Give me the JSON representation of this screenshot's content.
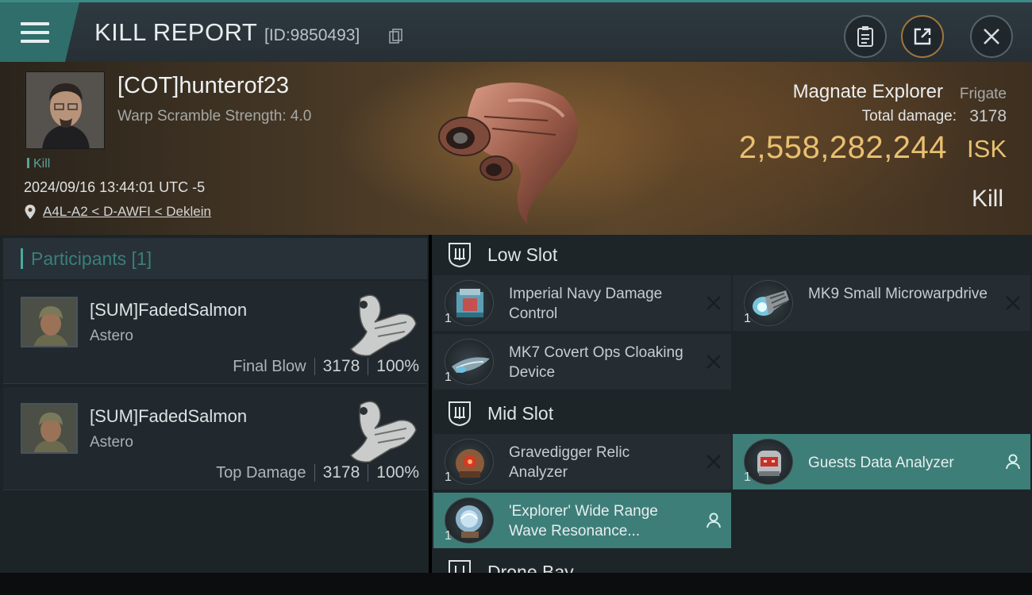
{
  "header": {
    "title": "KILL REPORT",
    "report_id": "[ID:9850493]"
  },
  "victim": {
    "name": "[COT]hunterof23",
    "warp_scramble": "Warp Scramble Strength: 4.0",
    "tag": "Kill",
    "datetime": "2024/09/16 13:44:01 UTC -5",
    "location": "A4L-A2 < D-AWFI < Deklein",
    "ship_name": "Magnate Explorer",
    "ship_class": "Frigate",
    "total_damage_label": "Total damage:",
    "total_damage": "3178",
    "isk_value": "2,558,282,244",
    "isk_unit": "ISK",
    "result": "Kill"
  },
  "participants": {
    "header": "Participants [1]",
    "rows": [
      {
        "name": "[SUM]FadedSalmon",
        "ship": "Astero",
        "role": "Final Blow",
        "damage": "3178",
        "percent": "100%"
      },
      {
        "name": "[SUM]FadedSalmon",
        "ship": "Astero",
        "role": "Top Damage",
        "damage": "3178",
        "percent": "100%"
      }
    ]
  },
  "slots": {
    "low": {
      "title": "Low Slot",
      "modules": [
        {
          "name": "Imperial Navy Damage Control",
          "qty": "1",
          "status": "destroyed"
        },
        {
          "name": "MK9 Small Microwarpdrive",
          "qty": "1",
          "status": "destroyed"
        },
        {
          "name": "MK7 Covert Ops Cloaking Device",
          "qty": "1",
          "status": "destroyed"
        }
      ]
    },
    "mid": {
      "title": "Mid Slot",
      "modules": [
        {
          "name": "Gravedigger Relic Analyzer",
          "qty": "1",
          "status": "destroyed"
        },
        {
          "name": "Guests Data Analyzer",
          "qty": "1",
          "status": "dropped"
        },
        {
          "name": "'Explorer' Wide Range Wave Resonance...",
          "qty": "1",
          "status": "dropped"
        }
      ]
    },
    "drone": {
      "title": "Drone Bay"
    }
  },
  "colors": {
    "accent_teal": "#3d7e78",
    "isk_gold": "#e8c070",
    "panel_bg": "#1e2529"
  }
}
